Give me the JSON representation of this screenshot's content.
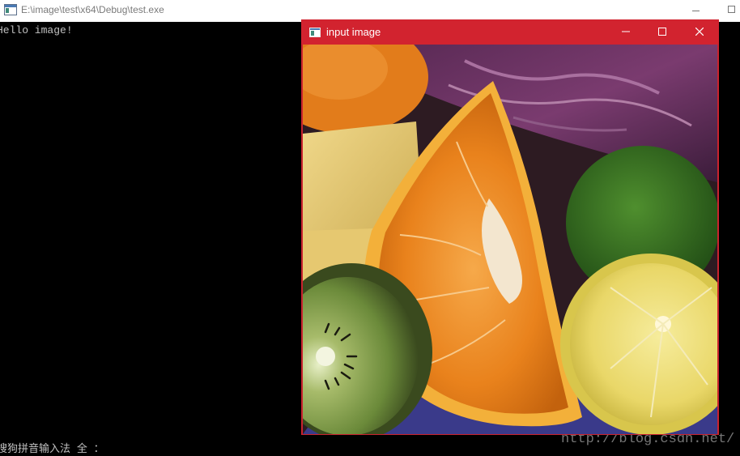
{
  "console": {
    "title": "E:\\image\\test\\x64\\Debug\\test.exe",
    "output": "Hello image!",
    "ime_status": "搜狗拼音输入法 全 ："
  },
  "image_window": {
    "title": "input image"
  },
  "watermark": "http://blog.csdn.net/",
  "icons": {
    "app": "app-window-icon",
    "minimize": "minimize-icon",
    "maximize": "maximize-icon",
    "close": "close-icon"
  },
  "colors": {
    "image_titlebar": "#d2232f",
    "console_bg": "#000000"
  }
}
